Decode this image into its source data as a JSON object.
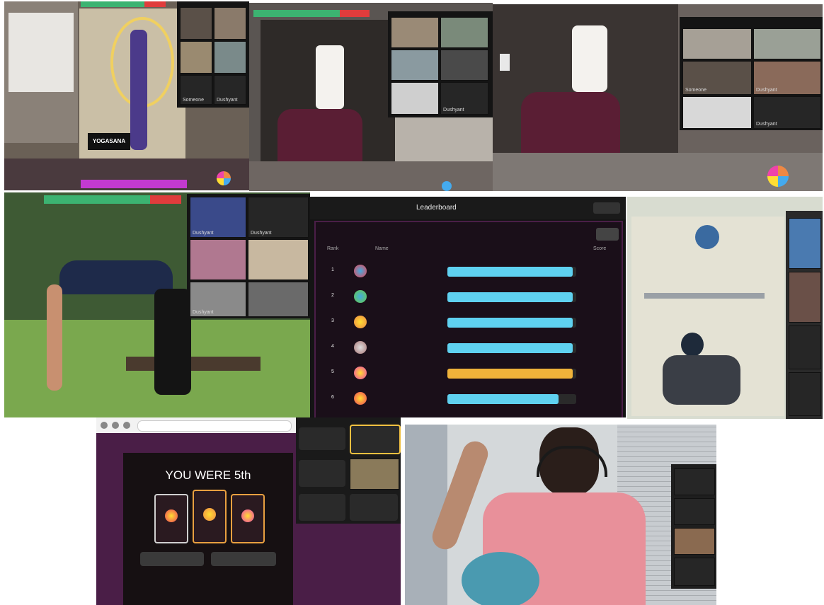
{
  "screens": {
    "top1": {
      "studio_sign": "YOGASANA",
      "tile_names": [
        "Someone",
        "Dushyant"
      ]
    },
    "top2": {
      "tile_names": [
        "Dushyant"
      ]
    },
    "top3": {
      "tile_names": [
        "Someone",
        "Dushyant",
        "Dushyant"
      ]
    },
    "mid1": {
      "tile_names": [
        "Dushyant",
        "Dushyant",
        "Dushyant"
      ]
    },
    "leaderboard": {
      "title": "Leaderboard",
      "subtitle": "",
      "close_label": "",
      "filter_label": "",
      "col_rank": "Rank",
      "col_name": "Name",
      "col_score": "Score",
      "rows": [
        {
          "rank": "1",
          "name": "",
          "score": "",
          "fill": 0.97,
          "color": "#5fd1f0"
        },
        {
          "rank": "2",
          "name": "",
          "score": "",
          "fill": 0.97,
          "color": "#5fd1f0"
        },
        {
          "rank": "3",
          "name": "",
          "score": "",
          "fill": 0.97,
          "color": "#5fd1f0"
        },
        {
          "rank": "4",
          "name": "",
          "score": "",
          "fill": 0.97,
          "color": "#5fd1f0"
        },
        {
          "rank": "5",
          "name": "",
          "score": "",
          "fill": 0.97,
          "color": "#f0b33a"
        },
        {
          "rank": "6",
          "name": "",
          "score": "",
          "fill": 0.86,
          "color": "#5fd1f0"
        }
      ]
    },
    "win": {
      "headline": "YOU WERE 5th",
      "card_labels": [
        "",
        "",
        ""
      ],
      "buttons": [
        "",
        ""
      ],
      "footer": "",
      "side_labels": [
        "",
        "",
        "",
        ""
      ]
    }
  },
  "colors": {
    "panel_dark": "#141414",
    "purple": "#4a1e47",
    "accent_green": "#3cb371",
    "accent_red": "#e03c3c"
  }
}
